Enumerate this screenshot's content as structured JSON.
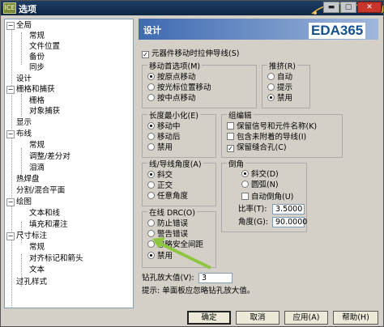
{
  "window": {
    "title": "选项",
    "app_icon": "ICE"
  },
  "titlebar": {
    "min_label": "▬",
    "max_label": "▢",
    "close_label": "✕"
  },
  "tree": {
    "items": [
      {
        "label": "全局",
        "expander": "−"
      },
      {
        "label": "常规"
      },
      {
        "label": "文件位置"
      },
      {
        "label": "备份"
      },
      {
        "label": "同步"
      },
      {
        "label": "设计"
      },
      {
        "label": "栅格和捕获",
        "expander": "−"
      },
      {
        "label": "栅格"
      },
      {
        "label": "对象捕获"
      },
      {
        "label": "显示"
      },
      {
        "label": "布线",
        "expander": "−"
      },
      {
        "label": "常规"
      },
      {
        "label": "调整/差分对"
      },
      {
        "label": "泪滴"
      },
      {
        "label": "热焊盘"
      },
      {
        "label": "分割/混合平面"
      },
      {
        "label": "绘图",
        "expander": "−"
      },
      {
        "label": "文本和线"
      },
      {
        "label": "填充和灌注"
      },
      {
        "label": "尺寸标注",
        "expander": "−"
      },
      {
        "label": "常规"
      },
      {
        "label": "对齐标记和箭头"
      },
      {
        "label": "文本"
      },
      {
        "label": "过孔样式"
      }
    ]
  },
  "panel": {
    "title": "设计",
    "logo": "EDA365",
    "stretch_traces": "元器件移动时拉伸导线(S)",
    "move_pref": {
      "title": "移动首选项(M)",
      "options": [
        "按原点移动",
        "按光标位置移动",
        "按中点移动"
      ],
      "selected": 0
    },
    "push": {
      "title": "推挤(R)",
      "options": [
        "自动",
        "提示",
        "禁用"
      ],
      "selected": 2
    },
    "length_min": {
      "title": "长度最小化(E)",
      "options": [
        "移动中",
        "移动后",
        "禁用"
      ],
      "selected": 0
    },
    "group": {
      "title": "组编辑",
      "options": [
        {
          "label": "保留信号和元件名称(K)",
          "checked": false
        },
        {
          "label": "包含未附着的导线(I)",
          "checked": false
        },
        {
          "label": "保留缝合孔(C)",
          "checked": true
        }
      ]
    },
    "line_angle": {
      "title": "线/导线角度(A)",
      "options": [
        "斜交",
        "正交",
        "任意角度"
      ],
      "selected": 0
    },
    "chamfer": {
      "title": "倒角",
      "options": [
        "斜交(D)",
        "圆弧(N)"
      ],
      "selected": 0,
      "auto_chamfer": "自动倒角(U)",
      "ratio_label": "比率(T):",
      "ratio_value": "3.5000",
      "angle_label": "角度(G):",
      "angle_value": "90.0000"
    },
    "online_drc": {
      "title": "在线 DRC(O)",
      "options": [
        "防止错误",
        "警告错误",
        "忽略安全间距",
        "禁用"
      ],
      "selected": 3
    },
    "drill_oversize_label": "钻孔放大值(V):",
    "drill_oversize_value": "3",
    "hint": "提示: 单面板应忽略钻孔放大值。"
  },
  "buttons": {
    "ok": "确定",
    "cancel": "取消",
    "apply": "应用(A)",
    "help": "帮助(H)"
  },
  "colors": {
    "header_start": "#3e6ab1",
    "header_end": "#9fb7dc",
    "logo": "#14518f",
    "arrow": "#8dc63f"
  }
}
